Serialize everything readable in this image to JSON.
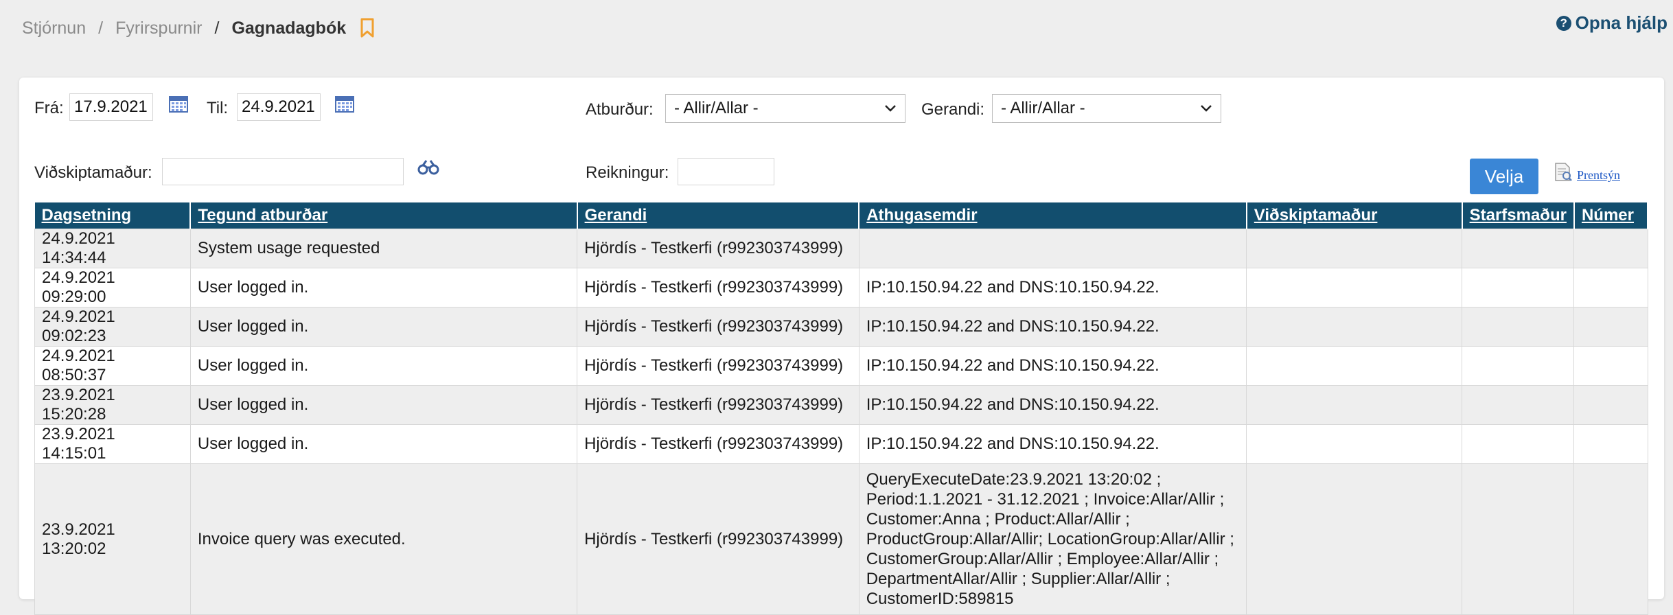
{
  "breadcrumb": {
    "items": [
      "Stjórnun",
      "Fyrirspurnir"
    ],
    "current": "Gagnadagbók"
  },
  "help": {
    "label": "Opna hjálp"
  },
  "filters": {
    "from_label": "Frá:",
    "from_value": "17.9.2021",
    "to_label": "Til:",
    "to_value": "24.9.2021",
    "event_label": "Atburður:",
    "event_value": "- Allir/Allar -",
    "actor_label": "Gerandi:",
    "actor_value": "- Allir/Allar -",
    "customer_label": "Viðskiptamaður:",
    "customer_value": "",
    "invoice_label": "Reikningur:",
    "invoice_value": "",
    "select_label": "Velja",
    "print_label": "Prentsýn"
  },
  "table": {
    "columns": [
      "Dagsetning",
      "Tegund atburðar",
      "Gerandi",
      "Athugasemdir",
      "Viðskiptamaður",
      "Starfsmaður",
      "Númer"
    ],
    "rows": [
      [
        "24.9.2021 14:34:44",
        "System usage requested",
        "Hjördís - Testkerfi (r992303743999)",
        "",
        "",
        "",
        ""
      ],
      [
        "24.9.2021 09:29:00",
        "User logged in.",
        "Hjördís - Testkerfi (r992303743999)",
        "IP:10.150.94.22 and DNS:10.150.94.22.",
        "",
        "",
        ""
      ],
      [
        "24.9.2021 09:02:23",
        "User logged in.",
        "Hjördís - Testkerfi (r992303743999)",
        "IP:10.150.94.22 and DNS:10.150.94.22.",
        "",
        "",
        ""
      ],
      [
        "24.9.2021 08:50:37",
        "User logged in.",
        "Hjördís - Testkerfi (r992303743999)",
        "IP:10.150.94.22 and DNS:10.150.94.22.",
        "",
        "",
        ""
      ],
      [
        "23.9.2021 15:20:28",
        "User logged in.",
        "Hjördís - Testkerfi (r992303743999)",
        "IP:10.150.94.22 and DNS:10.150.94.22.",
        "",
        "",
        ""
      ],
      [
        "23.9.2021 14:15:01",
        "User logged in.",
        "Hjördís - Testkerfi (r992303743999)",
        "IP:10.150.94.22 and DNS:10.150.94.22.",
        "",
        "",
        ""
      ],
      [
        "23.9.2021 13:20:02",
        "Invoice query was executed.",
        "Hjördís - Testkerfi (r992303743999)",
        "QueryExecuteDate:23.9.2021 13:20:02 ; Period:1.1.2021 - 31.12.2021 ; Invoice:Allar/Allir ; Customer:Anna ; Product:Allar/Allir ; ProductGroup:Allar/Allir; LocationGroup:Allar/Allir ; CustomerGroup:Allar/Allir ; Employee:Allar/Allir ; DepartmentAllar/Allir ; Supplier:Allar/Allir ; CustomerID:589815",
        "",
        "",
        ""
      ]
    ]
  },
  "colors": {
    "header_bg": "#124e6e",
    "accent": "#3a86d6",
    "bookmark": "#f0a030",
    "help": "#1b4f72"
  }
}
